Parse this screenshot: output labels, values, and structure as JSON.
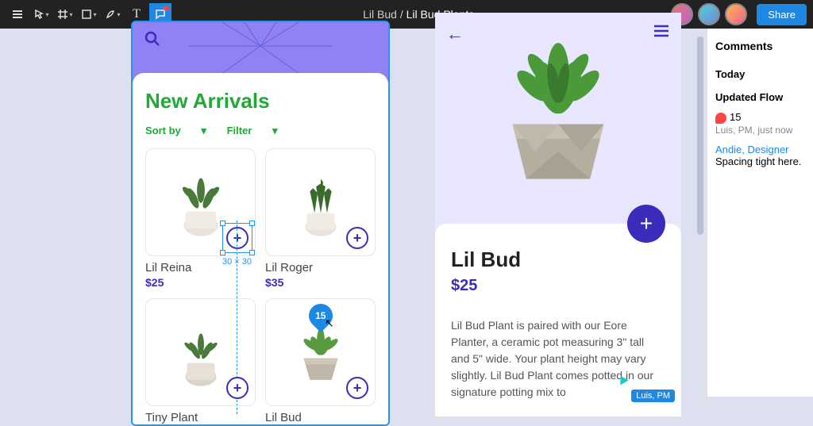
{
  "breadcrumb": {
    "folder": "Lil Bud",
    "file": "Lil Bud Plants"
  },
  "toolbar": {
    "share": "Share"
  },
  "arrivals": {
    "title": "New Arrivals",
    "sort": "Sort by",
    "filter": "Filter",
    "products": [
      {
        "name": "Lil Reina",
        "price": "$25"
      },
      {
        "name": "Lil Roger",
        "price": "$35"
      },
      {
        "name": "Tiny Plant",
        "price": ""
      },
      {
        "name": "Lil Bud",
        "price": ""
      }
    ],
    "selection_dim": "30 × 30",
    "pin_number": "15"
  },
  "detail": {
    "title": "Lil Bud",
    "price": "$25",
    "description": "Lil Bud Plant is paired with our Eore Planter, a ceramic pot measuring 3\" tall and 5\" wide. Your plant height may vary slightly. Lil Bud Plant comes potted in our signature potting mix to"
  },
  "cursor_tag": "Luis, PM",
  "comments": {
    "header": "Comments",
    "today": "Today",
    "flow": "Updated Flow",
    "item1_num": "15",
    "item1_meta": "Luis, PM, just now",
    "item2_author": "Andie, Designer",
    "item2_text": "Spacing tight here."
  }
}
